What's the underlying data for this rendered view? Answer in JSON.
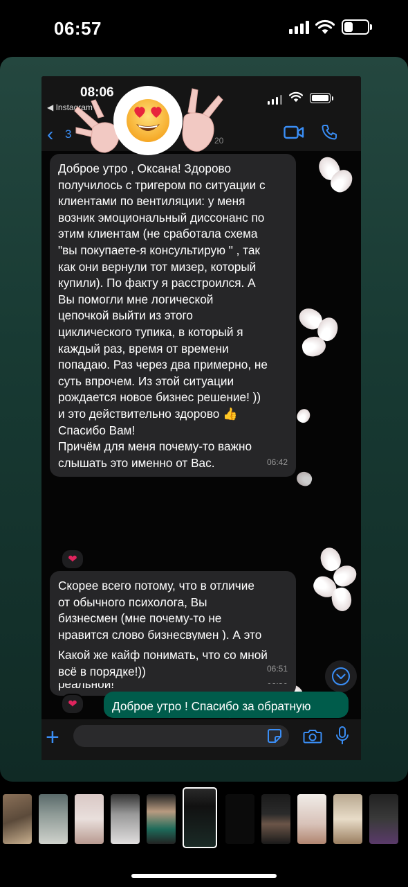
{
  "status_bar": {
    "time": "06:57"
  },
  "story": {
    "screenshot": {
      "status_time": "08:06",
      "back_app": "◀ Instagram",
      "header": {
        "back_count": "3",
        "last_seen": "20"
      },
      "messages": [
        {
          "text": "Доброе утро , Оксана! Здорово\nполучилось с тригером по ситуации с\nклиентами по вентиляции: у меня\nвозник эмоциональный диссонанс по\nэтим клиентам (не сработала схема\n\"вы покупаете-я консультирую \" , так\nкак они вернули тот мизер, который\nкупили). По факту  я расстроился.  А\nВы помогли мне логической\nцепочкой выйти из этого\nциклического тупика, в который я\nкаждый раз, время от времени\nпопадаю. Раз через два примерно, не\nсуть впрочем. Из этой ситуации\nрождается новое бизнес решение! ))\nи это действительно здорово 👍\nСпасибо Вам!\n Причём для меня почему-то важно\nслышать это именно от Вас.",
          "time": "06:42",
          "reaction": "❤"
        },
        {
          "text": "Скорее всего потому, что в отличие\nот обычного психолога, Вы\nбизнесмен (мне почему-то не\nнравится слово бизнесвумен ). А это\nзначит Вы можете отделить\nпсихологическую проблему от\nреальной!",
          "time": "06:50",
          "reaction": "❤"
        },
        {
          "text": "Какой же кайф понимать, что со мной\nвсё в порядке!))",
          "time": "06:51"
        }
      ],
      "outgoing_preview": "Доброе утро ! Спасибо за обратную\nсвязь ! В бизнесе собраться самой",
      "input": {
        "value": "",
        "placeholder": ""
      }
    },
    "overlay_emoji": "😍"
  },
  "colors": {
    "accent": "#3a8ef6",
    "card_bg": "#1f4039",
    "incoming_bubble": "#262628",
    "outgoing_bubble": "#005c4b",
    "reaction": "#e0245e"
  },
  "icons": [
    "signal-icon",
    "wifi-icon",
    "battery-icon",
    "back-chevron-icon",
    "video-call-icon",
    "phone-call-icon",
    "plus-icon",
    "sticker-icon",
    "camera-icon",
    "microphone-icon",
    "scroll-down-icon",
    "heart-reaction-icon"
  ]
}
